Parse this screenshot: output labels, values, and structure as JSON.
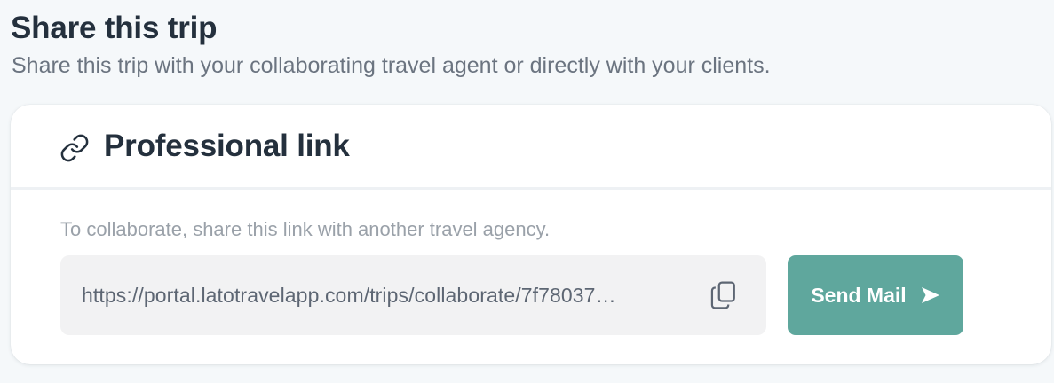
{
  "header": {
    "title": "Share this trip",
    "subtitle": "Share this trip with your collaborating travel agent or directly with your clients."
  },
  "card": {
    "title": "Professional link",
    "title_icon": "link-icon",
    "hint": "To collaborate, share this link with another travel agency.",
    "url": "https://portal.latotravelapp.com/trips/collaborate/7f78037…",
    "copy_icon": "copy-icon",
    "send_button_label": "Send Mail",
    "send_icon": "send-icon"
  },
  "colors": {
    "page_background": "#f5f8fa",
    "title_text": "#24303d",
    "subtitle_text": "#6b7480",
    "hint_text": "#9aa1a9",
    "url_box_background": "#f2f2f3",
    "send_button": "#5fa79d"
  }
}
